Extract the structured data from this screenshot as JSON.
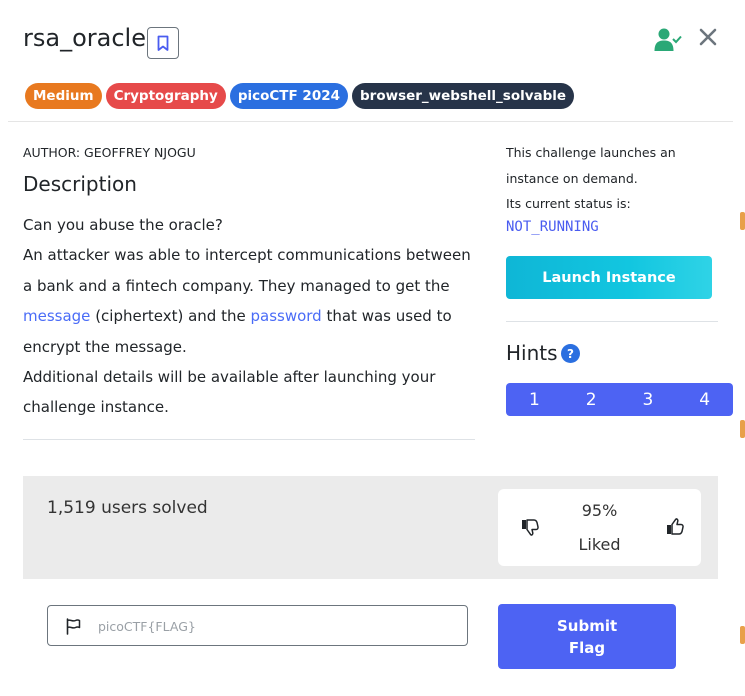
{
  "challenge": {
    "title": "rsa_oracle",
    "tags": [
      {
        "label": "Medium",
        "color": "#e8791f"
      },
      {
        "label": "Cryptography",
        "color": "#e64a4a"
      },
      {
        "label": "picoCTF 2024",
        "color": "#2b6fe0"
      },
      {
        "label": "browser_webshell_solvable",
        "color": "#273449"
      }
    ],
    "author": "AUTHOR: GEOFFREY NJOGU",
    "description_heading": "Description",
    "description": {
      "line1": "Can you abuse the oracle?",
      "line2_pre": "An attacker was able to intercept communications between a bank and a fintech company. They managed to get the ",
      "message_link": "message",
      "line2_mid": " (ciphertext) and the ",
      "password_link": "password",
      "line2_post": " that was used to encrypt the message.",
      "line3": "Additional details will be available after launching your challenge instance."
    }
  },
  "instance": {
    "line1": "This challenge launches an instance on demand.",
    "line2": "Its current status is:",
    "status": "NOT_RUNNING",
    "launch_label": "Launch Instance"
  },
  "hints": {
    "title": "Hints",
    "help_glyph": "?",
    "items": [
      "1",
      "2",
      "3",
      "4"
    ]
  },
  "stats": {
    "solved": "1,519 users solved",
    "liked_pct": "95%",
    "liked_word": "Liked"
  },
  "flag": {
    "placeholder": "picoCTF{FLAG}",
    "submit_label": "Submit Flag"
  },
  "icons": {
    "bookmark": "bookmark-icon",
    "user_check": "user-check-icon",
    "close": "close-icon",
    "thumb_down": "thumbs-down-icon",
    "thumb_up": "thumbs-up-icon",
    "flag": "flag-icon"
  },
  "colors": {
    "accent": "#4d63f3",
    "launch": "#12c6e0",
    "user_check": "#2aa876"
  }
}
